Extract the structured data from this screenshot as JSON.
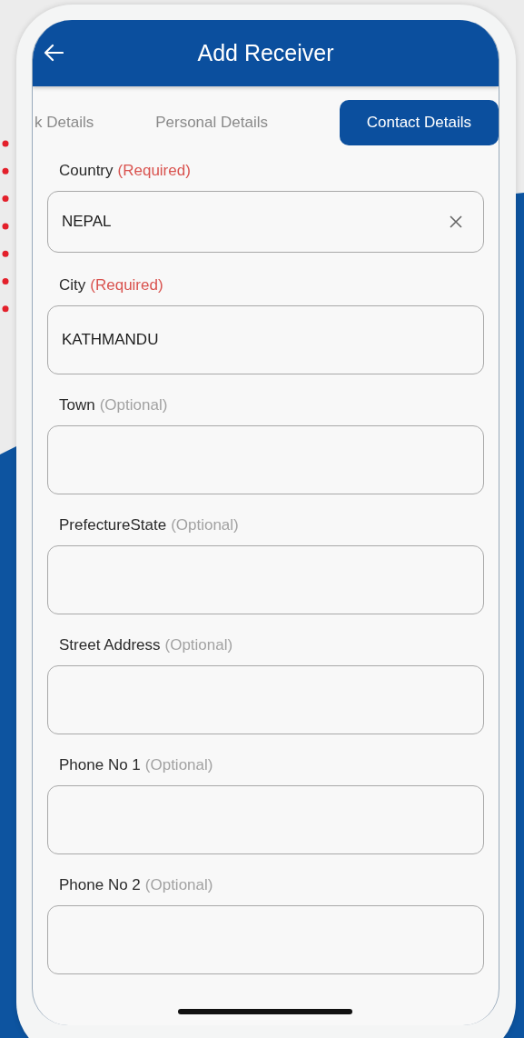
{
  "app_bar": {
    "title": "Add Receiver"
  },
  "tabs": [
    {
      "label": "k Details",
      "selected": false
    },
    {
      "label": "Personal Details",
      "selected": false
    },
    {
      "label": "Contact Details",
      "selected": true
    }
  ],
  "fields": [
    {
      "label": "Country",
      "qualifier": "(Required)",
      "required": true,
      "value": "NEPAL",
      "clearable": true
    },
    {
      "label": "City",
      "qualifier": "(Required)",
      "required": true,
      "value": "KATHMANDU",
      "clearable": false
    },
    {
      "label": "Town",
      "qualifier": "(Optional)",
      "required": false,
      "clearable": false
    },
    {
      "label": "PrefectureState",
      "qualifier": "(Optional)",
      "required": false,
      "clearable": false
    },
    {
      "label": "Street Address",
      "qualifier": "(Optional)",
      "required": false,
      "clearable": false
    },
    {
      "label": "Phone No 1",
      "qualifier": "(Optional)",
      "required": false,
      "clearable": false
    },
    {
      "label": "Phone No 2",
      "qualifier": "(Optional)",
      "required": false,
      "clearable": false
    }
  ]
}
